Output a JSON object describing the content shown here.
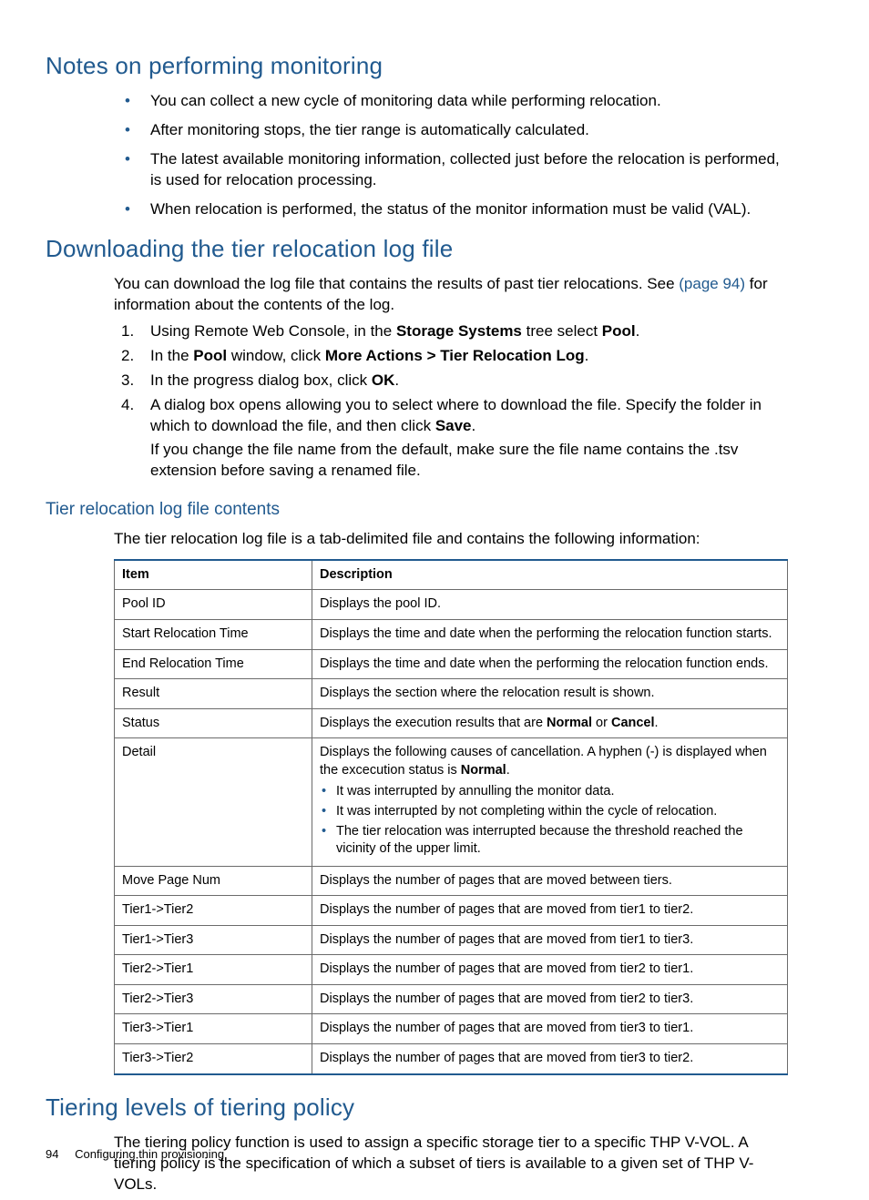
{
  "sec1": {
    "title": "Notes on performing monitoring",
    "bullets": [
      "You can collect a new cycle of monitoring data while performing relocation.",
      "After monitoring stops, the tier range is automatically calculated.",
      "The latest available monitoring information, collected just before the relocation is performed, is used for relocation processing.",
      "When relocation is performed, the status of the monitor information must be valid (VAL)."
    ]
  },
  "sec2": {
    "title": "Downloading the tier relocation log file",
    "intro_a": "You can download the log file that contains the results of past tier relocations. See ",
    "intro_link": "(page 94)",
    "intro_b": " for information about the contents of the log.",
    "s1_a": "Using Remote Web Console, in the ",
    "s1_b": "Storage Systems",
    "s1_c": " tree select ",
    "s1_d": "Pool",
    "s1_e": ".",
    "s2_a": "In the ",
    "s2_b": "Pool",
    "s2_c": " window, click ",
    "s2_d": "More Actions > Tier Relocation Log",
    "s2_e": ".",
    "s3_a": "In the progress dialog box, click ",
    "s3_b": "OK",
    "s3_c": ".",
    "s4_a": "A dialog box opens allowing you to select where to download the file. Specify the folder in which to download the file, and then click ",
    "s4_b": "Save",
    "s4_c": ".",
    "s4_sub": "If you change the file name from the default, make sure the file name contains the .tsv extension before saving a renamed file."
  },
  "sec3": {
    "title": "Tier relocation log file contents",
    "intro": "The tier relocation log file is a tab-delimited file and contains the following information:"
  },
  "table": {
    "h1": "Item",
    "h2": "Description",
    "rows": [
      {
        "item": "Pool ID",
        "desc": "Displays the pool ID."
      },
      {
        "item": "Start Relocation Time",
        "desc": "Displays the time and date when the performing the relocation function starts."
      },
      {
        "item": "End Relocation Time",
        "desc": "Displays the time and date when the performing the relocation function ends."
      },
      {
        "item": "Result",
        "desc": "Displays the section where the relocation result is shown."
      }
    ],
    "status": {
      "item": "Status",
      "a": "Displays the execution results that are ",
      "b": "Normal",
      "c": " or ",
      "d": "Cancel",
      "e": "."
    },
    "detail": {
      "item": "Detail",
      "a": "Displays the following causes of cancellation. A hyphen (-) is displayed when the excecution status is ",
      "b": "Normal",
      "c": ".",
      "li1": "It was interrupted by annulling the monitor data.",
      "li2": "It was interrupted by not completing within the cycle of relocation.",
      "li3": "The tier relocation was interrupted because the threshold reached the vicinity of the upper limit."
    },
    "rows2": [
      {
        "item": "Move Page Num",
        "desc": "Displays the number of pages that are moved between tiers."
      },
      {
        "item": "Tier1->Tier2",
        "desc": "Displays the number of pages that are moved from tier1 to tier2."
      },
      {
        "item": "Tier1->Tier3",
        "desc": "Displays the number of pages that are moved from tier1 to tier3."
      },
      {
        "item": "Tier2->Tier1",
        "desc": "Displays the number of pages that are moved from tier2 to tier1."
      },
      {
        "item": "Tier2->Tier3",
        "desc": "Displays the number of pages that are moved from tier2 to tier3."
      },
      {
        "item": "Tier3->Tier1",
        "desc": "Displays the number of pages that are moved from tier3 to tier1."
      },
      {
        "item": "Tier3->Tier2",
        "desc": "Displays the number of pages that are moved from tier3 to tier2."
      }
    ]
  },
  "sec4": {
    "title": "Tiering levels of tiering policy",
    "p": "The tiering policy function is used to assign a specific storage tier to a specific THP V-VOL. A tiering policy is the specification of which a subset of tiers is available to a given set of THP V-VOLs."
  },
  "footer": {
    "page": "94",
    "chapter": "Configuring thin provisioning"
  }
}
